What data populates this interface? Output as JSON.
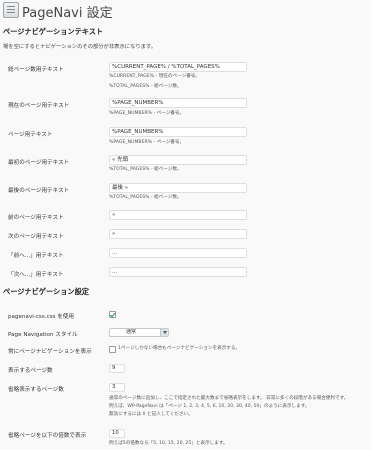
{
  "header": {
    "title": "PageNavi 設定"
  },
  "text_section": {
    "title": "ページナビゲーションテキスト",
    "description": "場を空にするとナビゲーションのその部分が非表示になります。",
    "rows": [
      {
        "label": "総ページ数用テキスト",
        "value": "%CURRENT_PAGE% / %TOTAL_PAGES%",
        "notes": [
          "%CURRENT_PAGE% - 現在のページ番号。",
          "%TOTAL_PAGES% - 総ページ数。"
        ]
      },
      {
        "label": "現在のページ用テキスト",
        "value": "%PAGE_NUMBER%",
        "notes": [
          "%PAGE_NUMBER% - ページ番号。"
        ]
      },
      {
        "label": "ページ用テキスト",
        "value": "%PAGE_NUMBER%",
        "notes": [
          "%PAGE_NUMBER% - ページ番号。"
        ]
      },
      {
        "label": "最初のページ用テキスト",
        "value": "« 先頭",
        "notes": [
          "%TOTAL_PAGES% - 総ページ数。"
        ]
      },
      {
        "label": "最後のページ用テキスト",
        "value": "最後 »",
        "notes": [
          "%TOTAL_PAGES% - 総ページ数。"
        ]
      },
      {
        "label": "前のページ用テキスト",
        "value": "«",
        "notes": []
      },
      {
        "label": "次のページ用テキスト",
        "value": "»",
        "notes": []
      },
      {
        "label": "「前へ...」用テキスト",
        "value": "...",
        "notes": []
      },
      {
        "label": "「次へ...」用テキスト",
        "value": "...",
        "notes": []
      }
    ]
  },
  "settings_section": {
    "title": "ページナビゲーション設定",
    "css_label": "pagenavi-css.css を使用",
    "css_checked": true,
    "style_label": "Page Navigation スタイル",
    "style_value": "通常",
    "always_label": "常にページナビゲーションを表示",
    "always_text": "1ページしかない場合もページナビゲーションを表示する。",
    "always_checked": false,
    "pages_label": "表示するページ数",
    "pages_value": "9",
    "larger_label": "省略表示するページ数",
    "larger_value": "3",
    "larger_notes": [
      "通常のページ数に追加し、ここで指定された最大数まで省略表示をします。 非常に多くの段階がある場合便利です。",
      "例えば、WP-PageNavi は「ページ 1, 2, 3, 4, 5, 6, 10, 20, 30, 40, 50」のように表示します。",
      "無効にするには 0 と記入してください。"
    ],
    "multiple_label": "省略ページを以下の倍数で表示",
    "multiple_value": "10",
    "multiple_note": "例えば5の倍数なら「5, 10, 15, 20, 25」と表示します。"
  }
}
